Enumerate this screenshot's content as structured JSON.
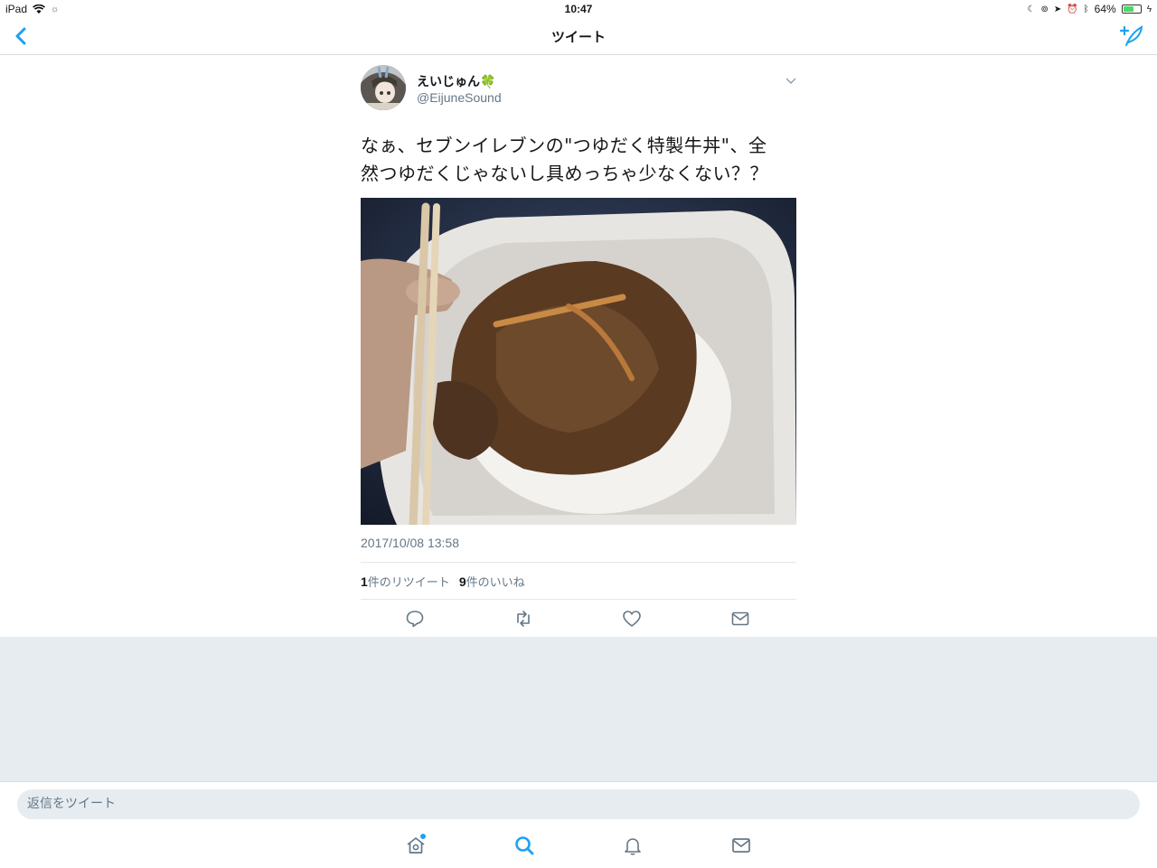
{
  "status_bar": {
    "device": "iPad",
    "time": "10:47",
    "battery": "64%",
    "battery_level": 0.64
  },
  "nav": {
    "title": "ツイート"
  },
  "tweet": {
    "user_name": "えいじゅん🍀",
    "user_handle": "@EijuneSound",
    "text_line1": "なぁ、セブンイレブンの\"つゆだく特製牛丼\"、全",
    "text_line2": "然つゆだくじゃないし具めっちゃ少なくない？？",
    "timestamp": "2017/10/08 13:58",
    "retweet_count": "1",
    "retweet_label": "件のリツイート",
    "like_count": "9",
    "like_label": "件のいいね"
  },
  "reply": {
    "placeholder": "返信をツイート"
  },
  "colors": {
    "accent": "#1da1f2",
    "muted": "#657786",
    "background_gray": "#e6ecf0"
  },
  "icons": {
    "back": "chevron-left-icon",
    "compose": "compose-tweet-icon",
    "reply": "reply-icon",
    "retweet": "retweet-icon",
    "like": "heart-icon",
    "dm": "envelope-icon",
    "home": "home-icon",
    "search": "search-icon",
    "notifications": "bell-icon",
    "messages": "envelope-icon"
  }
}
